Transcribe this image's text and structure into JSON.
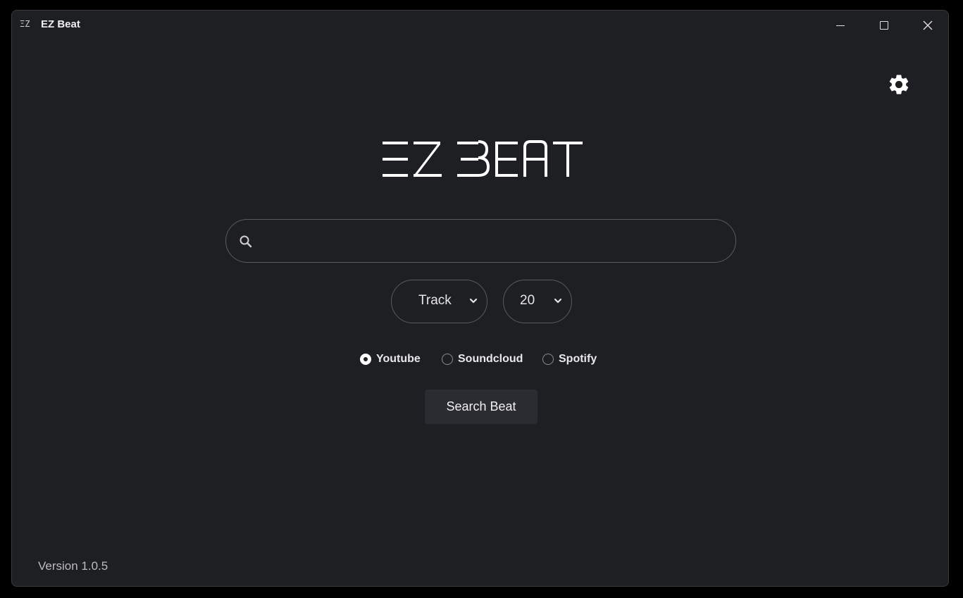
{
  "window": {
    "icon_text": "ΞZ",
    "title": "EZ Beat",
    "controls": [
      "minimize-icon",
      "maximize-icon",
      "close-icon"
    ]
  },
  "header": {
    "settings_icon": "gear-icon",
    "logo_text": "EZ BEAT"
  },
  "search": {
    "icon": "search-icon",
    "value": "",
    "placeholder": ""
  },
  "filters": {
    "type": {
      "selected": "Track",
      "icon": "chevron-down-icon"
    },
    "count": {
      "selected": "20",
      "icon": "chevron-down-icon"
    }
  },
  "sources": [
    {
      "label": "Youtube",
      "checked": true
    },
    {
      "label": "Soundcloud",
      "checked": false
    },
    {
      "label": "Spotify",
      "checked": false
    }
  ],
  "actions": {
    "search_label": "Search Beat"
  },
  "footer": {
    "version": "Version 1.0.5"
  },
  "colors": {
    "background": "#1e1f23",
    "outer": "#000000",
    "border": "#5a5b60",
    "button": "#2b2c31",
    "text": "#e6e6e6"
  }
}
